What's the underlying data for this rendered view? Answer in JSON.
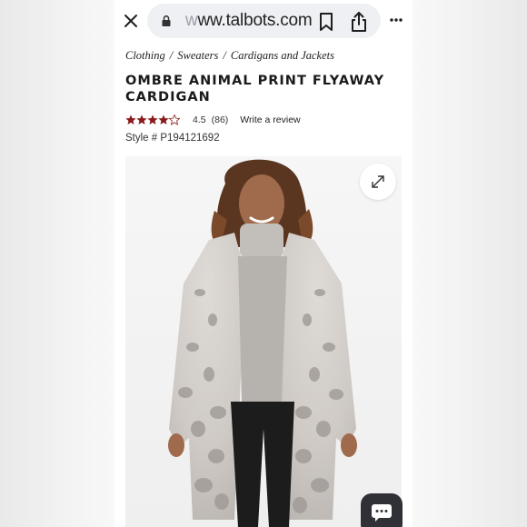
{
  "browser": {
    "url_faded": "w",
    "url_main": "ww.talbots.com",
    "icons": {
      "close": "close-icon",
      "lock": "lock-icon",
      "bookmark": "bookmark-icon",
      "share": "share-icon",
      "menu": "more-vert-icon"
    }
  },
  "breadcrumb": {
    "items": [
      "Clothing",
      "Sweaters",
      "Cardigans and Jackets"
    ],
    "separator": "/"
  },
  "product": {
    "title": "OMBRE ANIMAL PRINT FLYAWAY CARDIGAN",
    "rating_value": "4.5",
    "rating_stars": 4.5,
    "rating_count": "(86)",
    "write_review": "Write a review",
    "style_number": "Style # P194121692"
  },
  "image": {
    "expand_icon": "expand-icon",
    "chat_icon": "chat-icon"
  },
  "colors": {
    "star": "#8b1a1a",
    "url_pill": "#eef0f3",
    "chat_button": "#2f3136"
  }
}
